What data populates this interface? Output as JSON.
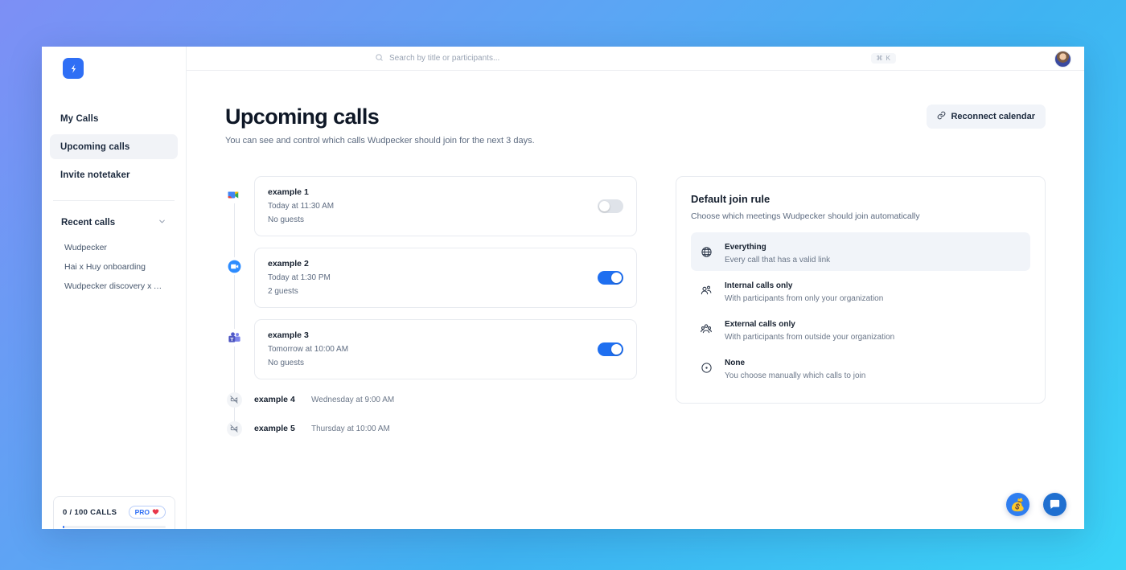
{
  "app": {
    "logo_icon": "wudpecker-bolt-icon"
  },
  "search": {
    "placeholder": "Search by title or participants...",
    "shortcut": "⌘ K",
    "icon": "search-icon"
  },
  "avatar": {
    "icon": "user-avatar"
  },
  "sidebar": {
    "nav": [
      {
        "label": "My Calls",
        "active": false
      },
      {
        "label": "Upcoming calls",
        "active": true
      },
      {
        "label": "Invite notetaker",
        "active": false
      }
    ],
    "recent_section": {
      "label": "Recent calls",
      "chevron_icon": "chevron-down-icon"
    },
    "recent_items": [
      {
        "label": "Wudpecker"
      },
      {
        "label": "Hai x Huy onboarding"
      },
      {
        "label": "Wudpecker discovery x Acme"
      }
    ],
    "usage": {
      "label": "0 / 100 CALLS",
      "badge": "PRO",
      "badge_icon": "heart-icon",
      "progress_percent": 0
    }
  },
  "page": {
    "title": "Upcoming calls",
    "subtitle": "You can see and control which calls Wudpecker should join for the next 3 days.",
    "reconnect_button": {
      "label": "Reconnect calendar",
      "icon": "link-icon"
    }
  },
  "calls": [
    {
      "title": "example 1",
      "time": "Today at 11:30 AM",
      "guests": "No guests",
      "platform_icon": "google-meet-icon",
      "toggle_on": false
    },
    {
      "title": "example 2",
      "time": "Today at 1:30 PM",
      "guests": "2 guests",
      "platform_icon": "zoom-icon",
      "toggle_on": true
    },
    {
      "title": "example 3",
      "time": "Tomorrow at 10:00 AM",
      "guests": "No guests",
      "platform_icon": "microsoft-teams-icon",
      "toggle_on": true
    }
  ],
  "simple_calls": [
    {
      "title": "example 4",
      "time": "Wednesday at 9:00 AM",
      "icon": "no-video-icon"
    },
    {
      "title": "example 5",
      "time": "Thursday at 10:00 AM",
      "icon": "no-video-icon"
    }
  ],
  "join_rule_panel": {
    "title": "Default join rule",
    "subtitle": "Choose which meetings Wudpecker should join automatically",
    "options": [
      {
        "name": "Everything",
        "desc": "Every call that has a valid link",
        "icon": "globe-icon",
        "selected": true
      },
      {
        "name": "Internal calls only",
        "desc": "With participants from only your organization",
        "icon": "two-people-icon",
        "selected": false
      },
      {
        "name": "External calls only",
        "desc": "With participants from outside your organization",
        "icon": "group-people-icon",
        "selected": false
      },
      {
        "name": "None",
        "desc": "You choose manually which calls to join",
        "icon": "circle-dot-icon",
        "selected": false
      }
    ]
  },
  "floating": {
    "money_button": {
      "icon": "money-bag-icon",
      "glyph": "💰"
    },
    "chat_button": {
      "icon": "intercom-chat-icon"
    }
  },
  "colors": {
    "accent": "#2f6ff5",
    "toggle_on": "#1f6ff0",
    "selected_row": "#f1f4f9",
    "bg_gradient_start": "#7d8ff5",
    "bg_gradient_end": "#3ad4f7"
  }
}
